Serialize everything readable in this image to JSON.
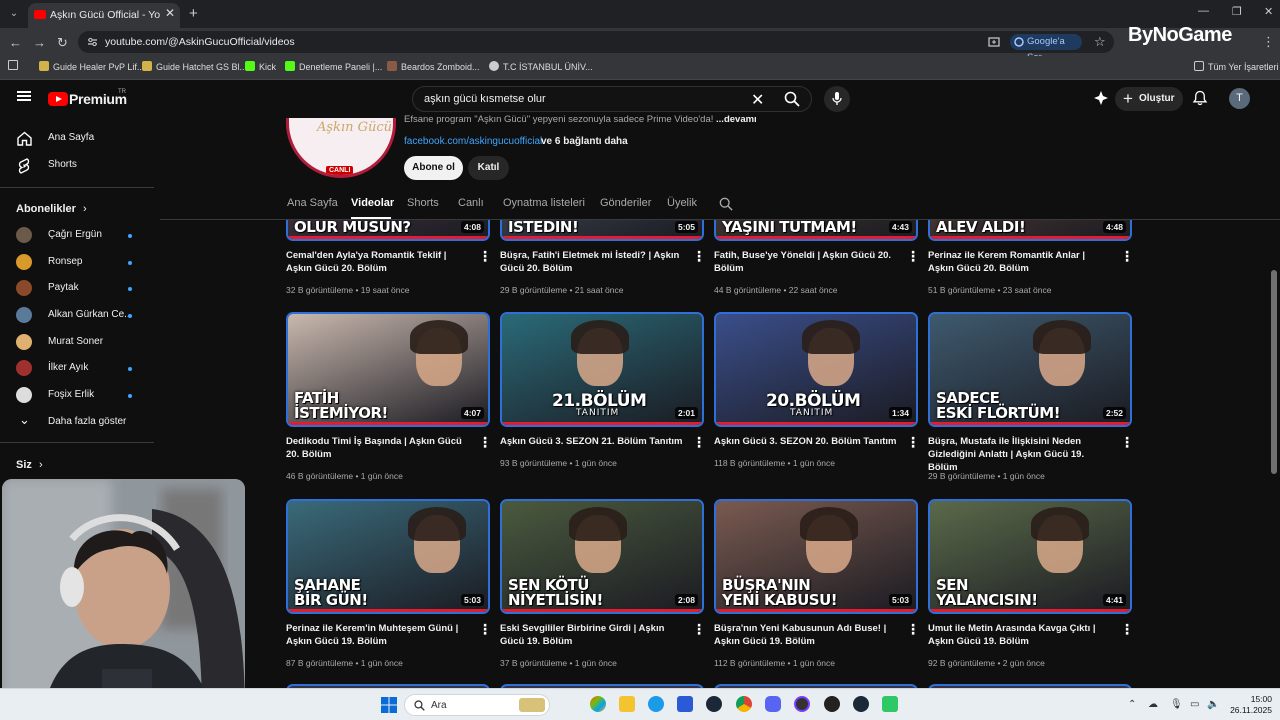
{
  "browser": {
    "tab_title": "Aşkın Gücü Official - YouTube",
    "url": "youtube.com/@AskinGucuOfficial/videos",
    "google_ask": "Google'a Sor",
    "watermark": "ByNoGame",
    "bookmarks": [
      {
        "label": "Guide Healer PvP Lif...",
        "color": "#d2b24a"
      },
      {
        "label": "Guide Hatchet GS Bl...",
        "color": "#d2b24a"
      },
      {
        "label": "Kick",
        "color": "#53fc18"
      },
      {
        "label": "Denetleme Paneli |...",
        "color": "#53fc18"
      },
      {
        "label": "Beardos Zomboid...",
        "color": "#8a5a44"
      },
      {
        "label": "T.C İSTANBUL ÜNİV...",
        "color": "#ccc"
      }
    ],
    "all_bookmarks": "Tüm Yer İşaretleri"
  },
  "youtube": {
    "logo_text": "Premium",
    "logo_tr": "TR",
    "search_value": "aşkın gücü kısmetse olur",
    "create_label": "Oluştur",
    "avatar_letter": "T"
  },
  "sidebar": {
    "home": "Ana Sayfa",
    "shorts": "Shorts",
    "subs_heading": "Abonelikler",
    "subscriptions": [
      {
        "name": "Çağrı Ergün",
        "color": "#6b5a4a",
        "dot": true
      },
      {
        "name": "Ronsep",
        "color": "#d89a2a",
        "dot": true
      },
      {
        "name": "Paytak",
        "color": "#8a4a2a",
        "dot": true
      },
      {
        "name": "Alkan Gürkan Ce...",
        "color": "#5a7a9a",
        "dot": true
      },
      {
        "name": "Murat Soner",
        "color": "#e0b070",
        "dot": false
      },
      {
        "name": "İlker Ayık",
        "color": "#a03030",
        "dot": true
      },
      {
        "name": "Foşix Erlik",
        "color": "#ddd",
        "dot": true
      }
    ],
    "show_more": "Daha fazla göster",
    "you_heading": "Siz"
  },
  "channel": {
    "avatar_text": "Aşkın Gücü",
    "live_badge": "CANLI",
    "desc_prefix": "Efsane program \"Aşkın Gücü\" yepyeni sezonuyla sadece Prime Video'da!",
    "desc_more": "...devamı",
    "link": "facebook.com/askingucuofficial",
    "link_more": "ve 6 bağlantı daha",
    "subscribe": "Abone ol",
    "join": "Katıl",
    "tabs": [
      "Ana Sayfa",
      "Videolar",
      "Shorts",
      "Canlı",
      "Oynatma listeleri",
      "Gönderiler",
      "Üyelik"
    ]
  },
  "videos": [
    {
      "caption": "OLUR MUSUN?",
      "duration": "4:08",
      "title": "Cemal'den Ayla'ya Romantik Teklif | Aşkın Gücü 20. Bölüm",
      "meta": "32 B görüntüleme • 19 saat önce",
      "tone": "#5b4050"
    },
    {
      "caption": "İSTEDİN!",
      "duration": "5:05",
      "title": "Büşra, Fatih'i Eletmek mi İstedi? | Aşkın Gücü 20. Bölüm",
      "meta": "29 B görüntüleme • 21 saat önce",
      "tone": "#4e5a6a"
    },
    {
      "caption": "YAŞINI TUTMAM!",
      "duration": "4:43",
      "title": "Fatih, Buse'ye Yöneldi | Aşkın Gücü 20. Bölüm",
      "meta": "44 B görüntüleme • 22 saat önce",
      "tone": "#5a4a3e"
    },
    {
      "caption": "ALEV ALDI!",
      "duration": "4:48",
      "title": "Perinaz ile Kerem Romantik Anlar | Aşkın Gücü 20. Bölüm",
      "meta": "51 B görüntüleme • 23 saat önce",
      "tone": "#6a4a40"
    },
    {
      "caption": "FATİH\nİSTEMİYOR!",
      "duration": "4:07",
      "title": "Dedikodu Timi İş Başında | Aşkın Gücü 20. Bölüm",
      "meta": "46 B görüntüleme • 1 gün önce",
      "tone": "#c9b8ae"
    },
    {
      "caption": "21.BÖLÜM",
      "sub": "TANITIM",
      "duration": "2:01",
      "title": "Aşkın Gücü 3. SEZON 21. Bölüm Tanıtım",
      "meta": "93 B görüntüleme • 1 gün önce",
      "tone": "#2a6a78"
    },
    {
      "caption": "20.BÖLÜM",
      "sub": "TANITIM",
      "duration": "1:34",
      "title": "Aşkın Gücü 3. SEZON 20. Bölüm Tanıtım",
      "meta": "118 B görüntüleme • 1 gün önce",
      "tone": "#3a4e8a"
    },
    {
      "caption": "SADECE\nESKİ FLÖRTÜM!",
      "duration": "2:52",
      "title": "Büşra, Mustafa ile İlişkisini Neden Gizlediğini Anlattı | Aşkın Gücü 19. Bölüm",
      "meta": "29 B görüntüleme • 1 gün önce",
      "tone": "#3e5a6e"
    },
    {
      "caption": "ŞAHANE\nBİR GÜN!",
      "duration": "5:03",
      "title": "Perinaz ile Kerem'in Muhteşem Günü | Aşkın Gücü 19. Bölüm",
      "meta": "87 B görüntüleme • 1 gün önce",
      "tone": "#3a6a7a"
    },
    {
      "caption": "SEN KÖTÜ\nNİYETLİSİN!",
      "duration": "2:08",
      "title": "Eski Sevgililer Birbirine Girdi | Aşkın Gücü 19. Bölüm",
      "meta": "37 B görüntüleme • 1 gün önce",
      "tone": "#4a5a3e"
    },
    {
      "caption": "BÜŞRA'NIN\nYENİ KABUSU!",
      "duration": "5:03",
      "title": "Büşra'nın Yeni Kabusunun Adı Buse! | Aşkın Gücü 19. Bölüm",
      "meta": "112 B görüntüleme • 1 gün önce",
      "tone": "#7a5a50"
    },
    {
      "caption": "SEN\nYALANCISIN!",
      "duration": "4:41",
      "title": "Umut ile Metin Arasında Kavga Çıktı | Aşkın Gücü 19. Bölüm",
      "meta": "92 B görüntüleme • 2 gün önce",
      "tone": "#5a6a4a"
    }
  ],
  "taskbar": {
    "search_placeholder": "Ara",
    "time": "15:00",
    "date": "26.11.2025"
  }
}
